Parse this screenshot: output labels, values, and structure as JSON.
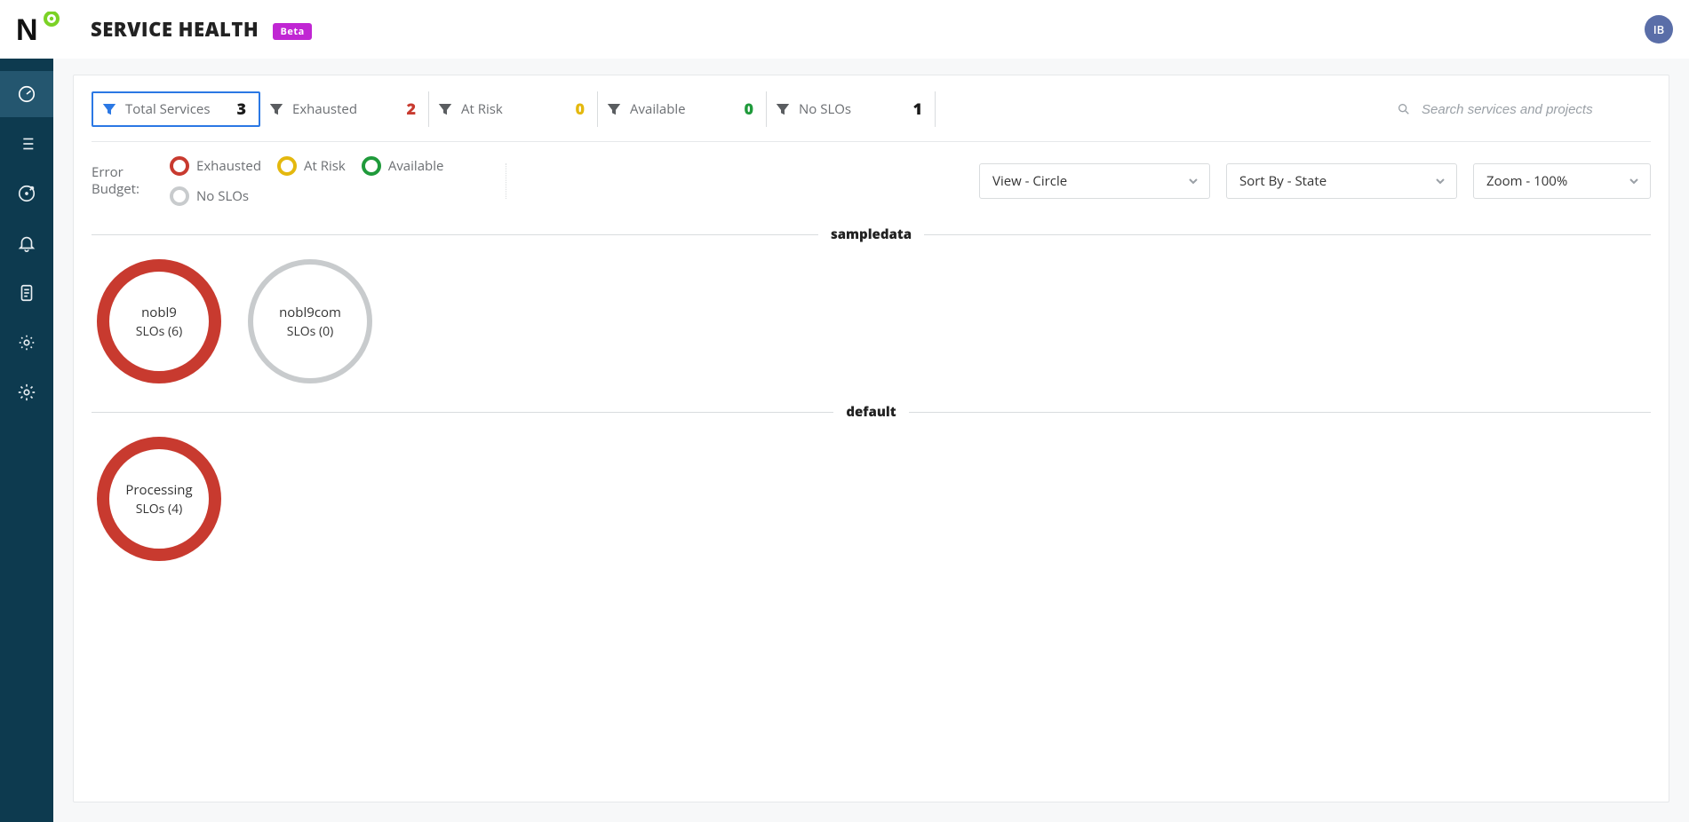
{
  "header": {
    "title": "SERVICE HEALTH",
    "badge": "Beta",
    "avatar_initials": "IB"
  },
  "sidebar": {
    "items": [
      {
        "name": "service-health",
        "active": true
      },
      {
        "name": "slo-list",
        "active": false
      },
      {
        "name": "targets",
        "active": false
      },
      {
        "name": "alerts",
        "active": false
      },
      {
        "name": "reports",
        "active": false
      },
      {
        "name": "integrations",
        "active": false
      },
      {
        "name": "settings",
        "active": false
      }
    ]
  },
  "filters": {
    "total": {
      "label": "Total Services",
      "count": "3"
    },
    "exhausted": {
      "label": "Exhausted",
      "count": "2"
    },
    "at_risk": {
      "label": "At Risk",
      "count": "0"
    },
    "available": {
      "label": "Available",
      "count": "0"
    },
    "no_slos": {
      "label": "No SLOs",
      "count": "1"
    }
  },
  "search": {
    "placeholder": "Search services and projects"
  },
  "legend": {
    "label_line1": "Error",
    "label_line2": "Budget:",
    "items": {
      "exhausted": "Exhausted",
      "at_risk": "At Risk",
      "available": "Available",
      "no_slos": "No SLOs"
    }
  },
  "controls": {
    "view": "View - Circle",
    "sort": "Sort By - State",
    "zoom": "Zoom - 100%"
  },
  "sections": [
    {
      "name": "sampledata",
      "services": [
        {
          "name": "nobl9",
          "slos": "SLOs (6)",
          "state": "red"
        },
        {
          "name": "nobl9com",
          "slos": "SLOs (0)",
          "state": "grey"
        }
      ]
    },
    {
      "name": "default",
      "services": [
        {
          "name": "Processing",
          "slos": "SLOs (4)",
          "state": "red"
        }
      ]
    }
  ]
}
